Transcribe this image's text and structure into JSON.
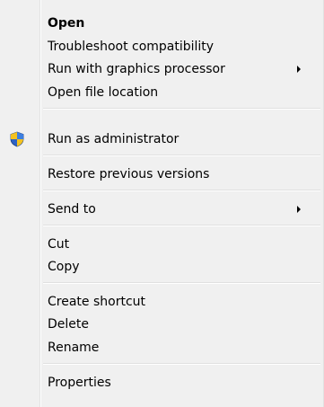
{
  "menu": {
    "items": [
      {
        "label": "Open",
        "bold": true
      },
      {
        "label": "Troubleshoot compatibility"
      },
      {
        "label": "Run with graphics processor",
        "submenu": true
      },
      {
        "label": "Open file location"
      },
      {
        "label": "Run as administrator",
        "icon": "uac-shield-icon"
      },
      {
        "label": "Restore previous versions"
      },
      {
        "label": "Send to",
        "submenu": true
      },
      {
        "label": "Cut"
      },
      {
        "label": "Copy"
      },
      {
        "label": "Create shortcut"
      },
      {
        "label": "Delete"
      },
      {
        "label": "Rename"
      },
      {
        "label": "Properties"
      }
    ]
  },
  "colors": {
    "menu_background": "#f0f0f0",
    "text": "#000000",
    "shield_blue": "#2f63c4",
    "shield_yellow": "#f4c21f"
  }
}
